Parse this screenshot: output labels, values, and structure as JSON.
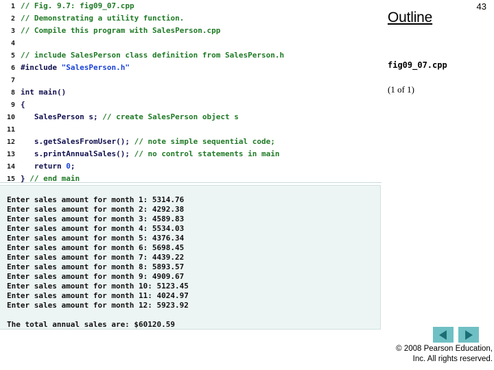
{
  "sidebar": {
    "page_number": "43",
    "heading": "Outline",
    "file_name": "fig09_07.cpp",
    "progress": "(1 of 1)",
    "nav": {
      "prev_label": "Previous slide",
      "next_label": "Next slide"
    },
    "copyright_line1": "© 2008 Pearson Education,",
    "copyright_line2": "Inc.  All rights reserved."
  },
  "code": {
    "lines": [
      {
        "n": "1",
        "segments": [
          {
            "t": "// Fig. 9.7: fig09_07.cpp",
            "c": "cmt"
          }
        ]
      },
      {
        "n": "2",
        "segments": [
          {
            "t": "// Demonstrating a utility function.",
            "c": "cmt"
          }
        ]
      },
      {
        "n": "3",
        "segments": [
          {
            "t": "// Compile this program with SalesPerson.cpp",
            "c": "cmt"
          }
        ]
      },
      {
        "n": "4",
        "segments": [
          {
            "t": "",
            "c": "plain"
          }
        ]
      },
      {
        "n": "5",
        "segments": [
          {
            "t": "// include SalesPerson class definition from SalesPerson.h",
            "c": "cmt"
          }
        ]
      },
      {
        "n": "6",
        "segments": [
          {
            "t": "#include ",
            "c": "kw"
          },
          {
            "t": "\"SalesPerson.h\"",
            "c": "str"
          }
        ]
      },
      {
        "n": "7",
        "segments": [
          {
            "t": "",
            "c": "plain"
          }
        ]
      },
      {
        "n": "8",
        "segments": [
          {
            "t": "int main()",
            "c": "kw"
          }
        ]
      },
      {
        "n": "9",
        "segments": [
          {
            "t": "{",
            "c": "plain"
          }
        ]
      },
      {
        "n": "10",
        "segments": [
          {
            "t": "   SalesPerson s; ",
            "c": "plain"
          },
          {
            "t": "// create SalesPerson object s",
            "c": "cmt"
          }
        ]
      },
      {
        "n": "11",
        "segments": [
          {
            "t": "",
            "c": "plain"
          }
        ]
      },
      {
        "n": "12",
        "segments": [
          {
            "t": "   s.getSalesFromUser(); ",
            "c": "plain"
          },
          {
            "t": "// note simple sequential code;",
            "c": "cmt"
          }
        ]
      },
      {
        "n": "13",
        "segments": [
          {
            "t": "   s.printAnnualSales(); ",
            "c": "plain"
          },
          {
            "t": "// no control statements in main",
            "c": "cmt"
          }
        ]
      },
      {
        "n": "14",
        "segments": [
          {
            "t": "   return ",
            "c": "kw"
          },
          {
            "t": "0",
            "c": "num"
          },
          {
            "t": ";",
            "c": "kw"
          }
        ]
      },
      {
        "n": "15",
        "segments": [
          {
            "t": "} ",
            "c": "plain"
          },
          {
            "t": "// end main",
            "c": "cmt"
          }
        ]
      }
    ]
  },
  "output": {
    "lines": [
      "Enter sales amount for month 1: 5314.76",
      "Enter sales amount for month 2: 4292.38",
      "Enter sales amount for month 3: 4589.83",
      "Enter sales amount for month 4: 5534.03",
      "Enter sales amount for month 5: 4376.34",
      "Enter sales amount for month 6: 5698.45",
      "Enter sales amount for month 7: 4439.22",
      "Enter sales amount for month 8: 5893.57",
      "Enter sales amount for month 9: 4909.67",
      "Enter sales amount for month 10: 5123.45",
      "Enter sales amount for month 11: 4024.97",
      "Enter sales amount for month 12: 5923.92",
      "",
      "The total annual sales are: $60120.59"
    ]
  },
  "colors": {
    "comment": "#1f7a26",
    "string": "#1a42d8",
    "keyword": "#11104f",
    "output_background": "#edf5f4",
    "nav_button": "#6fc0c4",
    "nav_arrow": "#1c6e75"
  }
}
